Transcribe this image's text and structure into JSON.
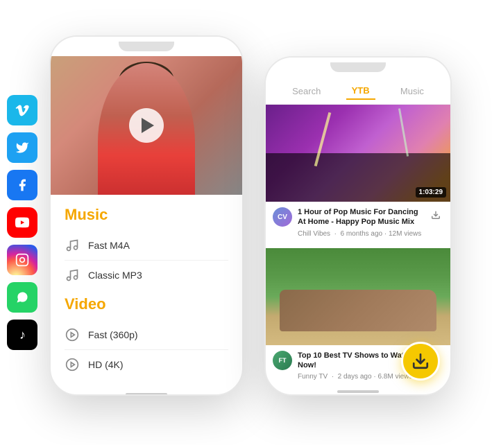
{
  "social": {
    "icons": [
      {
        "name": "vimeo",
        "label": "V",
        "class": "social-vimeo"
      },
      {
        "name": "twitter",
        "label": "🐦",
        "class": "social-twitter"
      },
      {
        "name": "facebook",
        "label": "f",
        "class": "social-facebook"
      },
      {
        "name": "youtube",
        "label": "▶",
        "class": "social-youtube"
      },
      {
        "name": "instagram",
        "label": "📷",
        "class": "social-instagram"
      },
      {
        "name": "whatsapp",
        "label": "✓",
        "class": "social-whatsapp"
      },
      {
        "name": "tiktok",
        "label": "♪",
        "class": "social-tiktok"
      }
    ]
  },
  "back_phone": {
    "music_section": {
      "title": "Music",
      "formats": [
        {
          "label": "Fast M4A"
        },
        {
          "label": "Classic MP3"
        }
      ]
    },
    "video_section": {
      "title": "Video",
      "formats": [
        {
          "label": "Fast (360p)"
        },
        {
          "label": "HD (4K)"
        }
      ]
    }
  },
  "front_phone": {
    "tabs": [
      {
        "label": "Search",
        "active": false
      },
      {
        "label": "YTB",
        "active": true
      },
      {
        "label": "Music",
        "active": false
      }
    ],
    "videos": [
      {
        "duration": "1:03:29",
        "title": "1 Hour of Pop Music For Dancing At Home - Happy Pop Music Mix",
        "channel": "Chill Vibes",
        "meta": "6 months ago · 12M views",
        "avatar_text": "CV"
      },
      {
        "title": "Top 10 Best TV Shows to Watch Right Now!",
        "channel": "Funny TV",
        "meta": "2 days ago · 6.8M views",
        "avatar_text": "FT"
      }
    ]
  }
}
